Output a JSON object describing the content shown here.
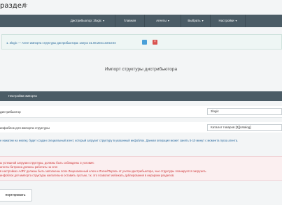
{
  "header": {
    "title": "раздел",
    "star": "☆"
  },
  "menu": [
    {
      "label": "Дистрибьютор: 3logic",
      "caret": "▾"
    },
    {
      "label": "Главная",
      "caret": ""
    },
    {
      "label": "Агенты",
      "caret": "▾"
    },
    {
      "label": "Выбрать",
      "caret": "▾"
    },
    {
      "label": "Настройки",
      "caret": "▾"
    }
  ],
  "notice": {
    "text": "1. 3logic — Агент импорта структуры дистрибьютора: запуск 31.08.2021 23:53:04",
    "delete_label": "×"
  },
  "panel": {
    "title": "Импорт структуры дистрибьютора"
  },
  "section": {
    "title": "Настройки импорта"
  },
  "fields": {
    "distributor": {
      "label": "дистрибьютор",
      "value": "3logic"
    },
    "infoblock": {
      "label": "инфоблок для импорта структуры",
      "value": "Каталог товаров [3][catalog]"
    }
  },
  "info": {
    "text": "е нажатии на кнопку, будет создан специальный агент, который загрузит структуру в указанный инфоблок. Данная операция может занять 5-10 минут с момента пуска агента."
  },
  "warning": {
    "lines": [
      "ы успешной загрузки структуры, должны быть соблюдены 3 условия:",
      "агенты битрикса должны работать на cron",
      "в настройках AdFlr должны быть заполнены поле Лицензионный ключ и Логин/Пароль от учетки дистрибьютора, чью структуры планируется загрузить",
      "инфоблок для импорта структуры желательно оставить пустым, т.к. это позволит избежать дублирования в иерархии разделов."
    ]
  },
  "actions": {
    "import_label": "портировать"
  }
}
